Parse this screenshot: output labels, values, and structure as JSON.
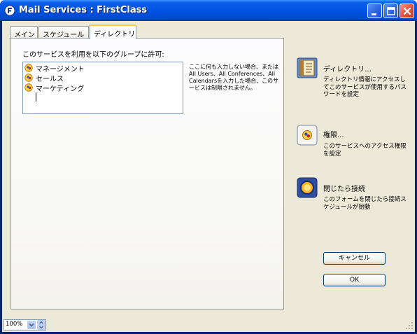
{
  "window": {
    "title": "Mail Services : FirstClass",
    "controls": {
      "minimize": "minimize-button",
      "maximize": "maximize-button",
      "close": "close-button"
    }
  },
  "tabs": [
    {
      "label": "メイン"
    },
    {
      "label": "スケジュール"
    },
    {
      "label": "ディレクトリ",
      "active": true
    }
  ],
  "directory": {
    "permission_label": "このサービスを利用を以下のグループに許可:",
    "groups": [
      "マネージメント",
      "セールス",
      "マーケティング"
    ],
    "note": "ここに何も入力しない場合、またはAll Users、All Conferences、All Calendarsを入力した場合、このサービスは制限されません。"
  },
  "actions": {
    "directory": {
      "title": "ディレクトリ...",
      "desc": "ディレクトリ情報にアクセスしてこのサービスが使用するパスワードを設定",
      "icon": "book-icon"
    },
    "permissions": {
      "title": "権限...",
      "desc": "このサービスへのアクセス権限を設定",
      "icon": "permissions-icon"
    },
    "close_connect": {
      "title": "閉じたら接続",
      "desc": "このフォームを閉じたら接続スケジュールが始動",
      "icon": "connect-icon"
    }
  },
  "buttons": {
    "cancel": "キャンセル",
    "ok": "OK"
  },
  "statusbar": {
    "zoom": "100%"
  },
  "colors": {
    "titlebar": "#0054e3",
    "tab_highlight": "#ffc83c",
    "window_bg": "#ece9d8",
    "button_border": "#003c74"
  }
}
